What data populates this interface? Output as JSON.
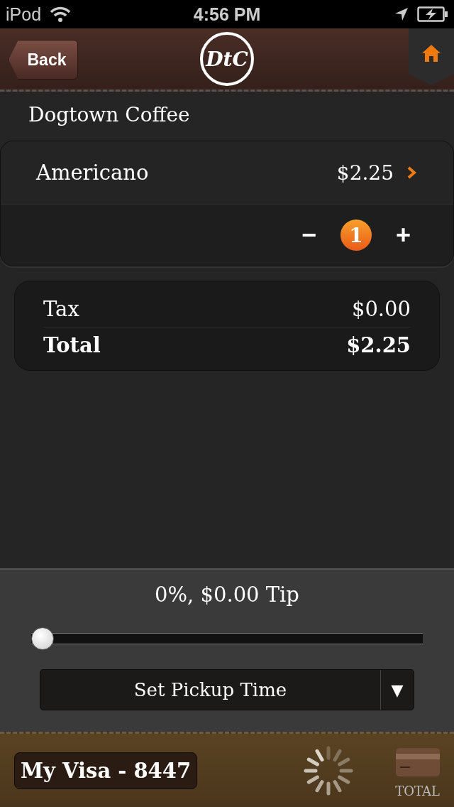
{
  "status_bar": {
    "carrier": "iPod",
    "time": "4:56 PM"
  },
  "nav": {
    "back": "Back",
    "logo": "DtC"
  },
  "store": "Dogtown Coffee",
  "items": [
    {
      "name": "Americano",
      "price": "$2.25",
      "quantity": "1",
      "minus": "−",
      "plus": "+"
    }
  ],
  "summary": [
    {
      "kind": "normal",
      "label": "Tax",
      "value": "$0.00"
    },
    {
      "kind": "total",
      "label": "Total",
      "value": "$2.25"
    }
  ],
  "tip": {
    "label": "0%, $0.00 Tip",
    "level": 0
  },
  "pickup": {
    "label": "Set Pickup Time",
    "caret": "▼"
  },
  "footer": {
    "card": "My Visa - 8447",
    "total_label": "TOTAL"
  }
}
